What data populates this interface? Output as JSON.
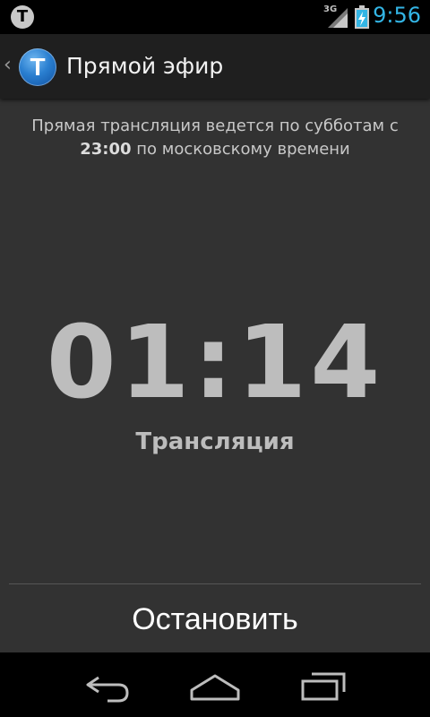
{
  "status_bar": {
    "notification_icon": "T",
    "network_type": "3G",
    "time": "9:56",
    "colors": {
      "clock": "#33b5e5"
    },
    "icons": [
      "app-notification-icon",
      "signal-icon",
      "battery-charging-icon"
    ]
  },
  "action_bar": {
    "app_logo_letter": "T",
    "title": "Прямой эфир",
    "icons": [
      "up-navigation-icon",
      "app-logo-icon"
    ]
  },
  "main": {
    "info_text_prefix": "Прямая трансляция ведется по субботам с",
    "info_time": "23:00",
    "info_text_suffix": "по московскому времени",
    "timer": "01:14",
    "timer_status": "Трансляция",
    "stop_button_label": "Остановить"
  },
  "nav_bar": {
    "icons": [
      "back-icon",
      "home-icon",
      "recent-apps-icon"
    ]
  }
}
